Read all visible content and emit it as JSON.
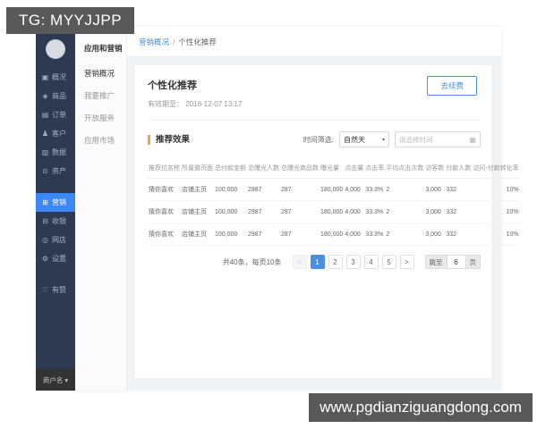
{
  "overlays": {
    "telegram_banner": "TG: MYYJJPP",
    "website_banner": "www.pgdianziguangdong.com"
  },
  "sidebar": {
    "items": [
      {
        "key": "overview",
        "label": "概况",
        "icon": "monitor-icon",
        "glyph": "▣",
        "active": false,
        "gap": false
      },
      {
        "key": "goods",
        "label": "商品",
        "icon": "tag-icon",
        "glyph": "◈",
        "active": false,
        "gap": false
      },
      {
        "key": "orders",
        "label": "订单",
        "icon": "order-list-icon",
        "glyph": "▤",
        "active": false,
        "gap": false
      },
      {
        "key": "customers",
        "label": "客户",
        "icon": "person-icon",
        "glyph": "♟",
        "active": false,
        "gap": false
      },
      {
        "key": "data",
        "label": "数据",
        "icon": "chart-icon",
        "glyph": "▥",
        "active": false,
        "gap": false
      },
      {
        "key": "assets",
        "label": "资产",
        "icon": "coin-icon",
        "glyph": "⊙",
        "active": false,
        "gap": false
      },
      {
        "key": "marketing",
        "label": "营销",
        "icon": "grid-icon",
        "glyph": "⊞",
        "active": true,
        "gap": true
      },
      {
        "key": "cashier",
        "label": "收银",
        "icon": "cashier-icon",
        "glyph": "⊟",
        "active": false,
        "gap": false
      },
      {
        "key": "shop",
        "label": "网店",
        "icon": "store-icon",
        "glyph": "◎",
        "active": false,
        "gap": false
      },
      {
        "key": "settings",
        "label": "设置",
        "icon": "gear-icon",
        "glyph": "⚙",
        "active": false,
        "gap": false
      },
      {
        "key": "youzan",
        "label": "有赞",
        "icon": "thumb-up-icon",
        "glyph": "♡",
        "active": false,
        "gap": true
      }
    ],
    "merchant_name": "商户名",
    "merchant_caret": "▾"
  },
  "subsidebar": {
    "title": "应用和营销",
    "items": [
      {
        "key": "marketing-overview",
        "label": "营销概况",
        "active": true
      },
      {
        "key": "promote",
        "label": "我要推广",
        "active": false
      },
      {
        "key": "open-services",
        "label": "开放服务",
        "active": false
      },
      {
        "key": "app-market",
        "label": "应用市场",
        "active": false
      }
    ]
  },
  "breadcrumb": {
    "parent": "营销概况",
    "separator": "/",
    "current": "个性化推荐"
  },
  "page": {
    "title": "个性化推荐",
    "validity": "有效期至： 2018-12-07 13:17",
    "renew_label": "去续费"
  },
  "section": {
    "title": "推荐效果",
    "filter_label": "时间筛选:",
    "filter_value": "自然天",
    "caret": "▾",
    "date_placeholder": "请选择时间",
    "calendar_glyph": "▦"
  },
  "table": {
    "headers": [
      "推荐位名称",
      "所属微页面",
      "总付款金额",
      "总曝光人数",
      "总曝光商品数",
      "曝光量",
      "点击量",
      "点击率",
      "平均点击次数",
      "访客数",
      "付款人数",
      "访问-付款转化率"
    ],
    "rows": [
      [
        "猜你喜欢",
        "店铺主页",
        "100,000",
        "2987",
        "287",
        "180,000",
        "4,000",
        "33.3%",
        "2",
        "3,000",
        "332",
        "10%"
      ],
      [
        "猜你喜欢",
        "店铺主页",
        "100,000",
        "2987",
        "287",
        "180,000",
        "4,000",
        "33.3%",
        "2",
        "3,000",
        "332",
        "10%"
      ],
      [
        "猜你喜欢",
        "店铺主页",
        "100,000",
        "2987",
        "287",
        "180,000",
        "4,000",
        "33.3%",
        "2",
        "3,000",
        "332",
        "10%"
      ]
    ]
  },
  "pagination": {
    "summary": "共40条，每页10条",
    "prev": "<",
    "pages": [
      "1",
      "2",
      "3",
      "4",
      "5"
    ],
    "active_page": "1",
    "next": ">",
    "jump_label": "跳至",
    "jump_value": "6",
    "jump_unit": "页"
  },
  "colors": {
    "sidebar_bg": "#2e3a52",
    "active_blue": "#3d87f5",
    "accent_blue": "#4a90e2",
    "section_orange": "#f0a64a",
    "banner_gray": "#595959",
    "content_bg": "#f0f2f5"
  }
}
